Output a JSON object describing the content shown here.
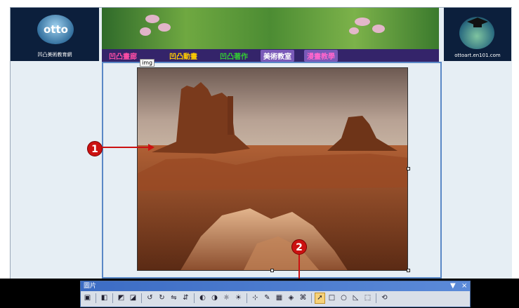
{
  "left_logo": {
    "label": "凹凸美術教育網"
  },
  "right_logo": {
    "label": "ottoart.en101.com"
  },
  "nav": {
    "items": [
      {
        "label": "凹凸畫廊",
        "color": "#ff4da6"
      },
      {
        "label": "凹凸動畫",
        "color": "#ffcc00"
      },
      {
        "label": "凹凸著作",
        "color": "#33cc33"
      },
      {
        "label": "美術教室",
        "color": "#ffffff"
      },
      {
        "label": "漫畫教學",
        "color": "#ff66cc"
      }
    ]
  },
  "image_tag": "img",
  "callouts": [
    "1",
    "2"
  ],
  "toolbar": {
    "title": "圖片",
    "menu_glyph": "▼",
    "close_glyph": "×",
    "tools": [
      "insert-picture-icon",
      "sep",
      "color-icon",
      "sep",
      "bring-forward-icon",
      "send-backward-icon",
      "sep",
      "rotate-left-icon",
      "rotate-right-icon",
      "flip-horizontal-icon",
      "flip-vertical-icon",
      "sep",
      "more-contrast-icon",
      "less-contrast-icon",
      "more-brightness-icon",
      "less-brightness-icon",
      "sep",
      "crop-icon",
      "recolor-icon",
      "bevel-icon",
      "set-transparent-color-icon",
      "resample-icon",
      "sep",
      "select-icon",
      "rectangle-hotspot-icon",
      "circle-hotspot-icon",
      "polygon-hotspot-icon",
      "highlight-hotspots-icon",
      "sep",
      "restore-icon"
    ],
    "glyphs": {
      "insert-picture-icon": "▣",
      "color-icon": "◧",
      "bring-forward-icon": "◩",
      "send-backward-icon": "◪",
      "rotate-left-icon": "↺",
      "rotate-right-icon": "↻",
      "flip-horizontal-icon": "⇋",
      "flip-vertical-icon": "⇵",
      "more-contrast-icon": "◐",
      "less-contrast-icon": "◑",
      "more-brightness-icon": "☼",
      "less-brightness-icon": "☀",
      "crop-icon": "⊹",
      "recolor-icon": "✎",
      "bevel-icon": "▦",
      "set-transparent-color-icon": "◈",
      "resample-icon": "⌘",
      "select-icon": "➚",
      "rectangle-hotspot-icon": "□",
      "circle-hotspot-icon": "○",
      "polygon-hotspot-icon": "◺",
      "highlight-hotspots-icon": "⬚",
      "restore-icon": "⟲"
    }
  },
  "colors": {
    "accent": "#cc1111",
    "frame_blue": "#5a88c6",
    "toolbar_title": "#3c6cc4"
  }
}
